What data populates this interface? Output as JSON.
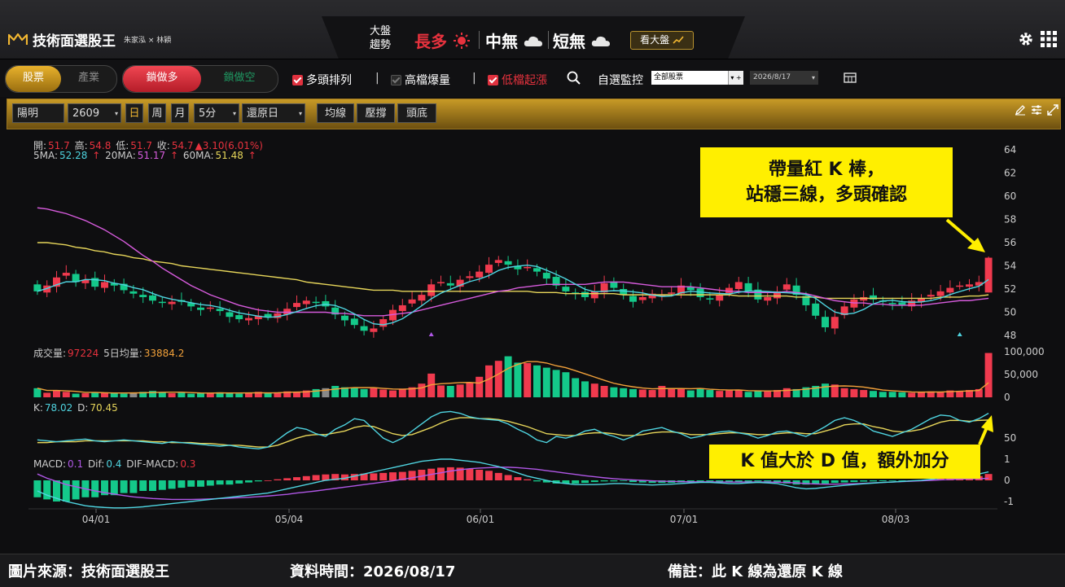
{
  "app": {
    "title": "技術面選股王",
    "subtitle": "朱家泓 × 林穎"
  },
  "market": {
    "label_line1": "大盤",
    "label_line2": "趨勢",
    "long_text": "長多",
    "mid_text": "中無",
    "short_text": "短無",
    "view_button": "看大盤",
    "colors": {
      "long": "#e8323e",
      "neutral": "#ffffff",
      "gold": "#b8922e"
    }
  },
  "toolbar": {
    "tab_stock": "股票",
    "tab_industry": "產業",
    "tab_lock_long": "鎖做多",
    "tab_lock_short": "鎖做空",
    "check_bull": "多頭排列",
    "check_volume": "高檔爆量",
    "check_lowrise": "低檔起漲",
    "watch_label": "自選監控",
    "watch_select": "全部股票",
    "date_value": "2026/8/17"
  },
  "goldbar": {
    "stock_name": "陽明",
    "stock_code": "2609",
    "period_day": "日",
    "period_week": "周",
    "period_month": "月",
    "interval": "5分",
    "restore": "還原日",
    "btn_ma": "均線",
    "btn_sr": "壓撐",
    "btn_top": "頭底"
  },
  "price_info": {
    "open_label": "開:",
    "open": "51.7",
    "high_label": "高:",
    "high": "54.8",
    "low_label": "低:",
    "low": "51.7",
    "close_label": "收:",
    "close": "54.7",
    "change": "▲3.10(6.01%)",
    "ma5_label": "5MA:",
    "ma5": "52.28",
    "ma20_label": "20MA:",
    "ma20": "51.17",
    "ma60_label": "60MA:",
    "ma60": "51.48",
    "up_arrow": "↑"
  },
  "volume_info": {
    "vol_label": "成交量:",
    "vol": "97224",
    "avg_label": "5日均量:",
    "avg": "33884.2"
  },
  "kd_info": {
    "k_label": "K:",
    "k": "78.02",
    "d_label": "D:",
    "d": "70.45"
  },
  "macd_info": {
    "macd_label": "MACD:",
    "macd": "0.1",
    "dif_label": "Dif:",
    "dif": "0.4",
    "osc_label": "DIF-MACD:",
    "osc": "0.3"
  },
  "axes": {
    "price_ticks": [
      "64",
      "62",
      "60",
      "58",
      "56",
      "54",
      "52",
      "50",
      "48"
    ],
    "volume_ticks": [
      "100,000",
      "50,000",
      "0"
    ],
    "kd_ticks": [
      "50"
    ],
    "macd_ticks": [
      "1",
      "0",
      "-1"
    ],
    "date_ticks": [
      "04/01",
      "05/04",
      "06/01",
      "07/01",
      "08/03"
    ]
  },
  "callouts": {
    "price_line1": "帶量紅 K 棒，",
    "price_line2": "站穩三線，多頭確認",
    "kd_text": "K 值大於 D 值，額外加分"
  },
  "footer": {
    "source": "圖片來源：技術面選股王",
    "time": "資料時間：2026/08/17",
    "note": "備註：此 K 線為還原 K 線"
  },
  "chart_data": {
    "type": "candlestick",
    "price_range": [
      47,
      65
    ],
    "close": [
      51.8,
      52.3,
      53.0,
      53.4,
      52.6,
      52.8,
      52.2,
      52.6,
      52.3,
      51.9,
      51.6,
      51.3,
      51.0,
      50.8,
      50.9,
      50.9,
      50.5,
      50.2,
      50.4,
      50.1,
      49.6,
      49.4,
      49.5,
      49.7,
      49.6,
      49.9,
      50.3,
      50.8,
      51.0,
      50.8,
      50.5,
      49.8,
      49.3,
      48.9,
      48.4,
      48.6,
      49.4,
      50.2,
      50.6,
      51.1,
      51.5,
      52.4,
      52.6,
      52.3,
      52.8,
      53.1,
      53.5,
      54.1,
      54.5,
      54.1,
      53.7,
      53.9,
      53.5,
      52.9,
      52.3,
      51.8,
      51.6,
      51.3,
      51.8,
      52.5,
      52.1,
      51.5,
      50.9,
      51.3,
      51.6,
      51.5,
      51.7,
      52.3,
      51.9,
      51.3,
      51.1,
      51.5,
      52.1,
      52.6,
      51.8,
      51.1,
      51.3,
      51.8,
      52.4,
      51.5,
      50.6,
      49.7,
      48.7,
      49.6,
      50.5,
      51.1,
      51.3,
      51.1,
      50.9,
      50.7,
      50.6,
      51.0,
      51.2,
      51.5,
      51.8,
      52.1,
      52.3,
      52.4,
      52.6,
      54.7
    ],
    "ma60": [
      56.0,
      56.0,
      55.9,
      55.8,
      55.6,
      55.5,
      55.3,
      55.2,
      55.0,
      54.9,
      54.7,
      54.6,
      54.4,
      54.3,
      54.2,
      54.0,
      53.9,
      53.8,
      53.7,
      53.6,
      53.5,
      53.4,
      53.3,
      53.2,
      53.1,
      53.0,
      52.9,
      52.8,
      52.6,
      52.5,
      52.4,
      52.3,
      52.2,
      52.1,
      52.0,
      51.9,
      51.9,
      51.9,
      51.8,
      51.8,
      51.8,
      51.8,
      51.8,
      51.8,
      51.8,
      51.8,
      51.8,
      51.8,
      51.8,
      51.8,
      51.8,
      51.8,
      51.7,
      51.7,
      51.7,
      51.6,
      51.6,
      51.6,
      51.6,
      51.6,
      51.6,
      51.5,
      51.5,
      51.5,
      51.5,
      51.5,
      51.5,
      51.5,
      51.5,
      51.5,
      51.5,
      51.5,
      51.5,
      51.4,
      51.4,
      51.4,
      51.4,
      51.4,
      51.4,
      51.3,
      51.3,
      51.3,
      51.2,
      51.2,
      51.2,
      51.2,
      51.2,
      51.2,
      51.2,
      51.2,
      51.2,
      51.2,
      51.2,
      51.2,
      51.3,
      51.3,
      51.3,
      51.4,
      51.4,
      51.5
    ],
    "ma20": [
      59.0,
      58.9,
      58.7,
      58.5,
      58.2,
      57.9,
      57.5,
      57.1,
      56.6,
      56.1,
      55.5,
      54.9,
      54.4,
      53.8,
      53.3,
      52.8,
      52.3,
      51.9,
      51.5,
      51.2,
      50.9,
      50.6,
      50.4,
      50.2,
      50.1,
      50.0,
      50.0,
      50.0,
      50.0,
      50.0,
      50.0,
      49.9,
      49.9,
      49.8,
      49.7,
      49.7,
      49.7,
      49.8,
      49.9,
      50.0,
      50.2,
      50.4,
      50.6,
      50.8,
      51.0,
      51.2,
      51.4,
      51.6,
      51.8,
      51.9,
      52.1,
      52.2,
      52.3,
      52.4,
      52.4,
      52.4,
      52.4,
      52.4,
      52.5,
      52.6,
      52.6,
      52.6,
      52.5,
      52.4,
      52.3,
      52.2,
      52.2,
      52.2,
      52.2,
      52.1,
      52.0,
      51.9,
      51.8,
      51.8,
      51.7,
      51.7,
      51.7,
      51.7,
      51.8,
      51.7,
      51.6,
      51.4,
      51.2,
      51.0,
      50.9,
      50.8,
      50.8,
      50.7,
      50.7,
      50.6,
      50.6,
      50.6,
      50.6,
      50.7,
      50.8,
      50.9,
      51.0,
      51.0,
      51.1,
      51.2
    ],
    "volume": [
      20000,
      10000,
      15000,
      12000,
      8000,
      9000,
      10000,
      11000,
      9000,
      8000,
      10000,
      12000,
      14000,
      11000,
      9000,
      10000,
      8000,
      9000,
      10000,
      11000,
      9000,
      8000,
      10000,
      12000,
      9000,
      11000,
      13000,
      12000,
      15000,
      18000,
      20000,
      25000,
      22000,
      21000,
      18000,
      20000,
      17000,
      15000,
      19000,
      22000,
      30000,
      52000,
      26000,
      25000,
      28000,
      32000,
      45000,
      70000,
      80000,
      90000,
      76000,
      75000,
      70000,
      65000,
      60000,
      55000,
      42000,
      35000,
      30000,
      25000,
      22000,
      20000,
      18000,
      17000,
      16000,
      25000,
      20000,
      18000,
      15000,
      20000,
      16000,
      14000,
      15000,
      16000,
      12000,
      14000,
      13000,
      16000,
      20000,
      18000,
      22000,
      25000,
      30000,
      28000,
      20000,
      18000,
      16000,
      14000,
      12000,
      12000,
      11000,
      10000,
      12000,
      13000,
      12000,
      15000,
      14000,
      16000,
      18000,
      97224
    ],
    "kd_k": [
      48,
      47,
      46,
      47,
      48,
      49,
      47,
      46,
      47,
      48,
      47,
      46,
      45,
      44,
      46,
      45,
      44,
      43,
      42,
      41,
      42,
      40,
      39,
      38,
      40,
      48,
      56,
      62,
      60,
      55,
      52,
      60,
      65,
      72,
      70,
      60,
      50,
      45,
      50,
      58,
      66,
      74,
      79,
      80,
      78,
      74,
      72,
      71,
      70,
      66,
      60,
      55,
      48,
      45,
      52,
      50,
      53,
      58,
      60,
      55,
      52,
      48,
      52,
      58,
      60,
      62,
      58,
      55,
      50,
      52,
      55,
      57,
      58,
      56,
      54,
      50,
      53,
      57,
      58,
      55,
      52,
      57,
      63,
      70,
      73,
      70,
      65,
      58,
      55,
      52,
      56,
      60,
      66,
      72,
      76,
      75,
      70,
      68,
      72,
      78
    ],
    "kd_d": [
      45,
      45,
      46,
      46,
      46,
      47,
      47,
      47,
      47,
      47,
      47,
      47,
      46,
      46,
      45,
      45,
      45,
      44,
      44,
      43,
      42,
      42,
      41,
      40,
      40,
      42,
      46,
      50,
      53,
      54,
      54,
      56,
      58,
      62,
      64,
      63,
      59,
      55,
      53,
      54,
      58,
      62,
      67,
      71,
      73,
      73,
      72,
      72,
      71,
      69,
      66,
      63,
      59,
      55,
      54,
      53,
      53,
      55,
      56,
      56,
      55,
      53,
      53,
      54,
      56,
      57,
      57,
      56,
      54,
      54,
      54,
      55,
      56,
      56,
      55,
      54,
      54,
      55,
      56,
      56,
      55,
      55,
      58,
      61,
      65,
      66,
      66,
      63,
      61,
      58,
      57,
      58,
      60,
      64,
      68,
      70,
      70,
      69,
      70,
      70.45
    ],
    "macd_osc": [
      -0.8,
      -0.9,
      -1.0,
      -1.0,
      -0.9,
      -0.8,
      -0.8,
      -0.7,
      -0.7,
      -0.6,
      -0.6,
      -0.5,
      -0.5,
      -0.45,
      -0.4,
      -0.35,
      -0.3,
      -0.3,
      -0.25,
      -0.2,
      -0.2,
      -0.15,
      -0.1,
      -0.05,
      0.0,
      0.05,
      0.1,
      0.15,
      0.2,
      0.25,
      0.28,
      0.3,
      0.28,
      0.3,
      0.32,
      0.33,
      0.35,
      0.38,
      0.4,
      0.45,
      0.5,
      0.55,
      0.6,
      0.62,
      0.6,
      0.55,
      0.5,
      0.45,
      0.35,
      0.25,
      0.15,
      0.05,
      -0.05,
      -0.1,
      -0.15,
      -0.15,
      -0.15,
      -0.12,
      -0.08,
      -0.05,
      -0.05,
      -0.03,
      -0.08,
      -0.1,
      -0.12,
      -0.12,
      -0.12,
      -0.1,
      -0.08,
      -0.06,
      -0.05,
      -0.06,
      -0.08,
      -0.08,
      -0.06,
      -0.05,
      -0.05,
      -0.08,
      -0.15,
      -0.2,
      -0.2,
      -0.18,
      -0.15,
      -0.12,
      -0.1,
      -0.08,
      -0.06,
      -0.05,
      -0.04,
      -0.03,
      -0.02,
      0.0,
      0.02,
      0.05,
      0.08,
      0.1,
      0.12,
      0.15,
      0.2,
      0.3
    ],
    "macd_dif": [
      -0.5,
      -0.7,
      -0.85,
      -1.0,
      -1.1,
      -1.2,
      -1.25,
      -1.28,
      -1.3,
      -1.3,
      -1.28,
      -1.25,
      -1.2,
      -1.15,
      -1.1,
      -1.05,
      -1.0,
      -0.95,
      -0.9,
      -0.85,
      -0.8,
      -0.75,
      -0.7,
      -0.65,
      -0.6,
      -0.5,
      -0.4,
      -0.3,
      -0.2,
      -0.1,
      0.0,
      0.05,
      0.1,
      0.2,
      0.3,
      0.4,
      0.5,
      0.6,
      0.7,
      0.8,
      0.9,
      0.95,
      1.0,
      1.0,
      0.95,
      0.9,
      0.85,
      0.75,
      0.65,
      0.5,
      0.35,
      0.2,
      0.1,
      0.0,
      -0.1,
      -0.15,
      -0.2,
      -0.2,
      -0.2,
      -0.18,
      -0.15,
      -0.15,
      -0.18,
      -0.2,
      -0.22,
      -0.2,
      -0.18,
      -0.15,
      -0.12,
      -0.1,
      -0.1,
      -0.12,
      -0.15,
      -0.15,
      -0.12,
      -0.1,
      -0.12,
      -0.15,
      -0.25,
      -0.35,
      -0.4,
      -0.38,
      -0.33,
      -0.28,
      -0.24,
      -0.2,
      -0.16,
      -0.13,
      -0.1,
      -0.08,
      -0.05,
      -0.02,
      0.0,
      0.05,
      0.1,
      0.15,
      0.2,
      0.25,
      0.3,
      0.4
    ],
    "macd_signal": [
      0.3,
      0.1,
      -0.05,
      -0.2,
      -0.3,
      -0.4,
      -0.5,
      -0.58,
      -0.65,
      -0.72,
      -0.78,
      -0.82,
      -0.86,
      -0.88,
      -0.9,
      -0.9,
      -0.9,
      -0.89,
      -0.88,
      -0.86,
      -0.84,
      -0.82,
      -0.8,
      -0.77,
      -0.74,
      -0.7,
      -0.66,
      -0.6,
      -0.55,
      -0.5,
      -0.44,
      -0.38,
      -0.32,
      -0.26,
      -0.2,
      -0.14,
      -0.08,
      -0.02,
      0.05,
      0.12,
      0.2,
      0.28,
      0.36,
      0.44,
      0.5,
      0.55,
      0.58,
      0.6,
      0.62,
      0.62,
      0.6,
      0.56,
      0.52,
      0.46,
      0.4,
      0.34,
      0.28,
      0.22,
      0.17,
      0.12,
      0.08,
      0.05,
      0.02,
      0.0,
      -0.02,
      -0.04,
      -0.05,
      -0.06,
      -0.07,
      -0.07,
      -0.07,
      -0.08,
      -0.08,
      -0.08,
      -0.08,
      -0.08,
      -0.08,
      -0.09,
      -0.1,
      -0.12,
      -0.15,
      -0.17,
      -0.18,
      -0.18,
      -0.17,
      -0.16,
      -0.14,
      -0.12,
      -0.1,
      -0.08,
      -0.06,
      -0.04,
      -0.02,
      0.0,
      0.02,
      0.04,
      0.06,
      0.07,
      0.08,
      0.1
    ]
  }
}
